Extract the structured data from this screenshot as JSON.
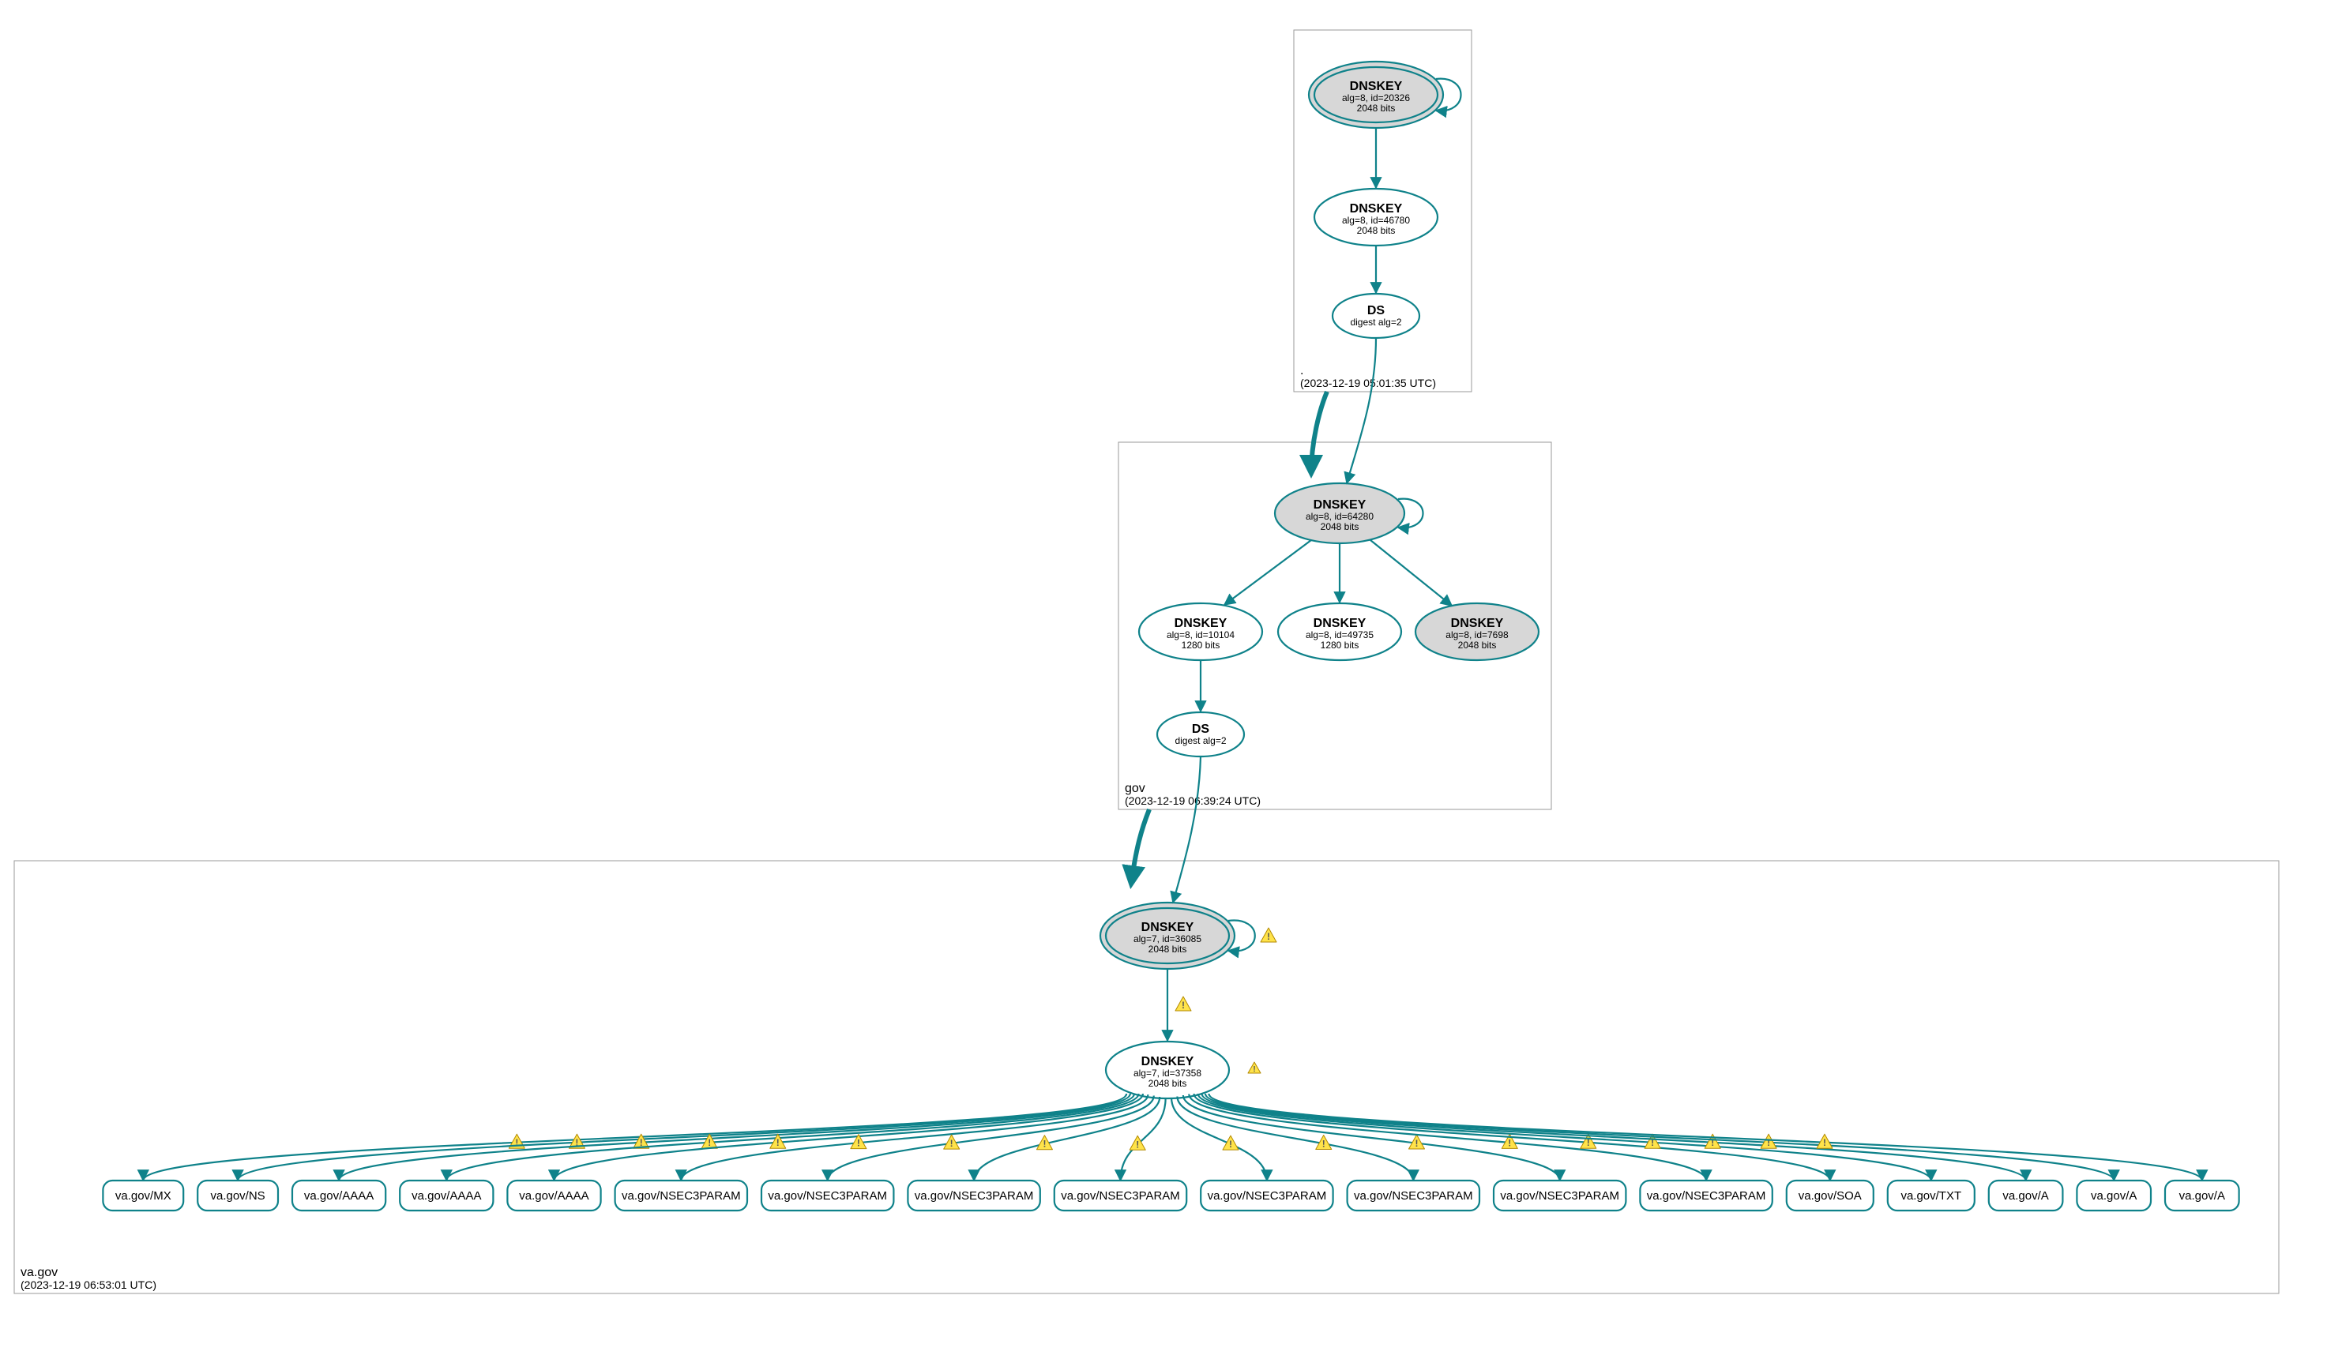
{
  "teal": "#0f828a",
  "grey_fill": "#d7d7d7",
  "zones": {
    "root": {
      "name": ".",
      "timestamp": "(2023-12-19 05:01:35 UTC)"
    },
    "gov": {
      "name": "gov",
      "timestamp": "(2023-12-19 06:39:24 UTC)"
    },
    "va": {
      "name": "va.gov",
      "timestamp": "(2023-12-19 06:53:01 UTC)"
    }
  },
  "nodes": {
    "root_ksk": {
      "title": "DNSKEY",
      "line1": "alg=8, id=20326",
      "line2": "2048 bits"
    },
    "root_zsk": {
      "title": "DNSKEY",
      "line1": "alg=8, id=46780",
      "line2": "2048 bits"
    },
    "root_ds": {
      "title": "DS",
      "line1": "digest alg=2",
      "line2": ""
    },
    "gov_ksk": {
      "title": "DNSKEY",
      "line1": "alg=8, id=64280",
      "line2": "2048 bits"
    },
    "gov_zsk1": {
      "title": "DNSKEY",
      "line1": "alg=8, id=10104",
      "line2": "1280 bits"
    },
    "gov_zsk2": {
      "title": "DNSKEY",
      "line1": "alg=8, id=49735",
      "line2": "1280 bits"
    },
    "gov_extra": {
      "title": "DNSKEY",
      "line1": "alg=8, id=7698",
      "line2": "2048 bits"
    },
    "gov_ds": {
      "title": "DS",
      "line1": "digest alg=2",
      "line2": ""
    },
    "va_ksk": {
      "title": "DNSKEY",
      "line1": "alg=7, id=36085",
      "line2": "2048 bits"
    },
    "va_zsk": {
      "title": "DNSKEY",
      "line1": "alg=7, id=37358",
      "line2": "2048 bits"
    }
  },
  "rrsets": [
    "va.gov/MX",
    "va.gov/NS",
    "va.gov/AAAA",
    "va.gov/AAAA",
    "va.gov/AAAA",
    "va.gov/NSEC3PARAM",
    "va.gov/NSEC3PARAM",
    "va.gov/NSEC3PARAM",
    "va.gov/NSEC3PARAM",
    "va.gov/NSEC3PARAM",
    "va.gov/NSEC3PARAM",
    "va.gov/NSEC3PARAM",
    "va.gov/NSEC3PARAM",
    "va.gov/SOA",
    "va.gov/TXT",
    "va.gov/A",
    "va.gov/A",
    "va.gov/A"
  ]
}
